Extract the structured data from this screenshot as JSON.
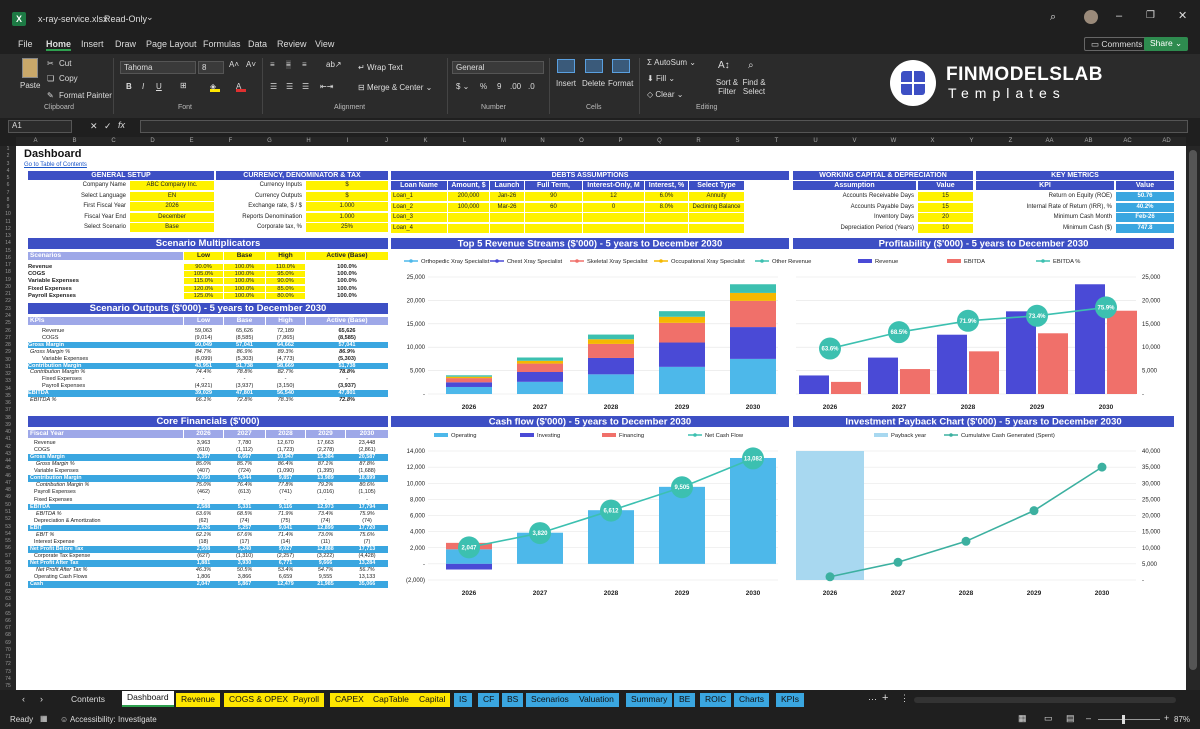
{
  "window": {
    "filename": "x-ray-service.xlsx",
    "mode": "Read-Only"
  },
  "menu": [
    "File",
    "Home",
    "Insert",
    "Draw",
    "Page Layout",
    "Formulas",
    "Data",
    "Review",
    "View"
  ],
  "menu_active": "Home",
  "topright": {
    "comments": "Comments",
    "share": "Share"
  },
  "ribbon": {
    "paste": "Paste",
    "cut": "Cut",
    "copy": "Copy",
    "format_painter": "Format Painter",
    "clipboard": "Clipboard",
    "font_name": "Tahoma",
    "font_size": "8",
    "font_label": "Font",
    "wrap": "Wrap Text",
    "merge": "Merge & Center",
    "alignment": "Alignment",
    "number_format": "General",
    "number": "Number",
    "insert": "Insert",
    "delete": "Delete",
    "format": "Format",
    "cells": "Cells",
    "autosum": "AutoSum",
    "fill": "Fill",
    "clear": "Clear",
    "sort": "Sort & Filter",
    "find": "Find & Select",
    "editing": "Editing",
    "logo_main": "FINMODELSLAB",
    "logo_sub": "Templates"
  },
  "formula": {
    "namebox": "A1",
    "fx": "fx"
  },
  "columns": [
    "A",
    "B",
    "C",
    "D",
    "E",
    "F",
    "G",
    "H",
    "I",
    "J",
    "K",
    "L",
    "M",
    "N",
    "O",
    "P",
    "Q",
    "R",
    "S",
    "T",
    "U",
    "V",
    "W",
    "X",
    "Y",
    "Z",
    "AA",
    "AB",
    "AC",
    "AD"
  ],
  "sheet": {
    "title": "Dashboard",
    "link": "Go to Table of Contents",
    "general_setup": {
      "header": "GENERAL SETUP",
      "rows": [
        [
          "Company Name",
          "ABC Company Inc."
        ],
        [
          "Select Language",
          "EN"
        ],
        [
          "First Fiscal Year",
          "2026"
        ],
        [
          "Fiscal Year End",
          "December"
        ],
        [
          "Select Scenario",
          "Base"
        ]
      ]
    },
    "currency": {
      "header": "CURRENCY, DENOMINATOR & TAX",
      "rows": [
        [
          "Currency Inputs",
          "$"
        ],
        [
          "Currency Outputs",
          "$"
        ],
        [
          "Exchange rate, $ / $",
          "1.000"
        ],
        [
          "Reports Denomination",
          "1.000"
        ],
        [
          "Corporate tax, %",
          "25%"
        ]
      ]
    },
    "debts": {
      "header": "DEBTS ASSUMPTIONS",
      "cols": [
        "Loan Name",
        "Amount, $",
        "Launch",
        "Full Term, Months",
        "Interest-Only, M",
        "Interest, %",
        "Select Type"
      ],
      "rows": [
        [
          "Loan_1",
          "200,000",
          "Jan-26",
          "90",
          "12",
          "6.0%",
          "Annuity"
        ],
        [
          "Loan_2",
          "100,000",
          "Mar-26",
          "60",
          "0",
          "8.0%",
          "Declining Balance"
        ],
        [
          "Loan_3",
          "",
          "",
          "",
          "",
          "",
          ""
        ],
        [
          "Loan_4",
          "",
          "",
          "",
          "",
          "",
          ""
        ]
      ]
    },
    "wc": {
      "header": "WORKING CAPITAL & DEPRECIATION",
      "cols": [
        "Assumption",
        "Value"
      ],
      "rows": [
        [
          "Accounts Receivable Days",
          "15"
        ],
        [
          "Accounts Payable Days",
          "15"
        ],
        [
          "Inventory Days",
          "20"
        ],
        [
          "Depreciation Period (Years)",
          "10"
        ]
      ]
    },
    "kpi": {
      "header": "KEY METRICS",
      "cols": [
        "KPI",
        "Value"
      ],
      "rows": [
        [
          "Return on Equity (ROE)",
          "50.76"
        ],
        [
          "Internal Rate of Return (IRR), %",
          "40.2%"
        ],
        [
          "Minimum Cash Month",
          "Feb-26"
        ],
        [
          "Minimum Cash ($)",
          "747.8"
        ]
      ]
    },
    "multipliers": {
      "header": "Scenario Multiplicators",
      "cols": [
        "Scenarios",
        "Low",
        "Base",
        "High",
        "Active (Base)"
      ],
      "rows": [
        [
          "Revenue",
          "90.0%",
          "100.0%",
          "110.0%",
          "100.0%"
        ],
        [
          "COGS",
          "105.0%",
          "100.0%",
          "95.0%",
          "100.0%"
        ],
        [
          "Variable Expenses",
          "115.0%",
          "100.0%",
          "90.0%",
          "100.0%"
        ],
        [
          "Fixed Expenses",
          "120.0%",
          "100.0%",
          "85.0%",
          "100.0%"
        ],
        [
          "Payroll Expenses",
          "125.0%",
          "100.0%",
          "80.0%",
          "100.0%"
        ]
      ]
    },
    "outputs": {
      "header": "Scenario Outputs ($'000) - 5 years to December 2030",
      "cols": [
        "KPIs",
        "Low",
        "Base",
        "High",
        "Active (Base)"
      ],
      "rows": [
        [
          "Revenue",
          "59,063",
          "65,626",
          "72,189",
          "65,626",
          ""
        ],
        [
          "COGS",
          "(9,014)",
          "(8,585)",
          "(7,865)",
          "(8,585)",
          ""
        ],
        [
          "Gross Margin",
          "50,049",
          "57,041",
          "64,662",
          "57,041",
          "h"
        ],
        [
          "Gross Margin %",
          "84.7%",
          "86.9%",
          "89.3%",
          "86.9%",
          "i"
        ],
        [
          "Variable Expenses",
          "(6,099)",
          "(5,303)",
          "(4,773)",
          "(5,303)",
          ""
        ],
        [
          "Contribution Margin",
          "43,951",
          "51,738",
          "58,669",
          "51,738",
          "h"
        ],
        [
          "Contribution Margin %",
          "74.4%",
          "78.8%",
          "82.7%",
          "78.8%",
          "i"
        ],
        [
          "Fixed Expenses",
          "-",
          "-",
          "-",
          "-",
          ""
        ],
        [
          "Payroll Expenses",
          "(4,921)",
          "(3,937)",
          "(3,150)",
          "(3,937)",
          ""
        ],
        [
          "EBITDA",
          "39,029",
          "47,801",
          "56,540",
          "47,801",
          "h"
        ],
        [
          "EBITDA %",
          "66.1%",
          "72.8%",
          "78.3%",
          "72.8%",
          "i"
        ]
      ]
    },
    "core": {
      "header": "Core Financials ($'000)",
      "cols": [
        "Fiscal Year",
        "2026",
        "2027",
        "2028",
        "2029",
        "2030"
      ],
      "rows": [
        [
          "Revenue",
          "3,963",
          "7,780",
          "12,670",
          "17,663",
          "23,448",
          ""
        ],
        [
          "COGS",
          "(610)",
          "(1,112)",
          "(1,723)",
          "(2,278)",
          "(2,861)",
          ""
        ],
        [
          "Gross Margin",
          "3,357",
          "6,667",
          "10,947",
          "15,384",
          "20,587",
          "h"
        ],
        [
          "Gross Margin %",
          "85.0%",
          "85.7%",
          "86.4%",
          "87.1%",
          "87.8%",
          "i"
        ],
        [
          "Variable Expenses",
          "(407)",
          "(724)",
          "(1,090)",
          "(1,395)",
          "(1,688)",
          ""
        ],
        [
          "Contribution Margin",
          "3,050",
          "5,944",
          "9,857",
          "13,989",
          "18,899",
          "h"
        ],
        [
          "Contribution Margin %",
          "75.0%",
          "76.4%",
          "77.8%",
          "79.2%",
          "80.6%",
          "i"
        ],
        [
          "Payroll Expenses",
          "(462)",
          "(613)",
          "(741)",
          "(1,016)",
          "(1,105)",
          ""
        ],
        [
          "Fixed Expenses",
          "-",
          "-",
          "-",
          "-",
          "-",
          ""
        ],
        [
          "EBITDA",
          "2,588",
          "5,331",
          "9,116",
          "12,973",
          "17,794",
          "h"
        ],
        [
          "EBITDA %",
          "63.6%",
          "68.5%",
          "71.9%",
          "73.4%",
          "75.9%",
          "i"
        ],
        [
          "Depreciation & Amortization",
          "(62)",
          "(74)",
          "(75)",
          "(74)",
          "(74)",
          ""
        ],
        [
          "EBIT",
          "2,526",
          "5,257",
          "9,041",
          "12,899",
          "17,720",
          "h"
        ],
        [
          "EBIT %",
          "62.1%",
          "67.6%",
          "71.4%",
          "73.0%",
          "75.6%",
          "i"
        ],
        [
          "Interest Expense",
          "(18)",
          "(17)",
          "(14)",
          "(11)",
          "(7)",
          ""
        ],
        [
          "Net Profit Before Tax",
          "2,508",
          "5,240",
          "9,027",
          "12,888",
          "17,713",
          "h"
        ],
        [
          "Corporate Tax Expense",
          "(627)",
          "(1,310)",
          "(2,257)",
          "(3,222)",
          "(4,428)",
          ""
        ],
        [
          "Net Profit After Tax",
          "1,881",
          "3,930",
          "6,771",
          "9,666",
          "13,284",
          "h"
        ],
        [
          "Net Profit After Tax %",
          "46.3%",
          "50.5%",
          "53.4%",
          "54.7%",
          "56.7%",
          "i"
        ],
        [
          "Operating Cash Flows",
          "1,806",
          "3,866",
          "6,659",
          "9,555",
          "13,133",
          ""
        ],
        [
          "Cash",
          "2,047",
          "5,867",
          "12,479",
          "21,985",
          "35,066",
          "h"
        ]
      ]
    }
  },
  "charts": {
    "revenue_streams": {
      "title": "Top 5 Revenue Streams ($'000) - 5 years to December 2030",
      "type": "bar",
      "legend": [
        "Orthopedic Xray Specialist",
        "Chest Xray Specialist",
        "Skeletal Xray Specialist",
        "Occupational Xray Specialist",
        "Other Revenue"
      ],
      "colors": [
        "#4db8ea",
        "#4a4ad6",
        "#f0706a",
        "#f5b800",
        "#3cc0b0"
      ],
      "categories": [
        "2026",
        "2027",
        "2028",
        "2029",
        "2030"
      ],
      "series": [
        [
          1500,
          2600,
          4200,
          5800,
          7500
        ],
        [
          1000,
          2100,
          3500,
          5200,
          6800
        ],
        [
          900,
          1800,
          3000,
          4200,
          5600
        ],
        [
          300,
          600,
          1000,
          1300,
          1700
        ],
        [
          300,
          700,
          1000,
          1200,
          1850
        ]
      ],
      "yticks": [
        "-",
        "5,000",
        "10,000",
        "15,000",
        "20,000",
        "25,000"
      ],
      "ymax": 25000
    },
    "profitability": {
      "title": "Profitability ($'000) - 5 years to December 2030",
      "type": "bar",
      "legend": [
        "Revenue",
        "EBITDA",
        "EBITDA %"
      ],
      "colors": [
        "#4a4ad6",
        "#f0706a",
        "#3cc0b0"
      ],
      "categories": [
        "2026",
        "2027",
        "2028",
        "2029",
        "2030"
      ],
      "revenue": [
        3963,
        7780,
        12670,
        17663,
        23448
      ],
      "ebitda": [
        2588,
        5331,
        9116,
        12973,
        17794
      ],
      "pct": [
        "63.6%",
        "68.5%",
        "71.9%",
        "73.4%",
        "75.9%"
      ],
      "pctv": [
        63.6,
        68.5,
        71.9,
        73.4,
        75.9
      ],
      "yticks": [
        "-",
        "5,000",
        "10,000",
        "15,000",
        "20,000",
        "25,000"
      ],
      "ymax": 25000
    },
    "cashflow": {
      "title": "Cash flow ($'000) - 5 years to December 2030",
      "type": "bar",
      "legend": [
        "Operating",
        "Investing",
        "Financing",
        "Net Cash Flow"
      ],
      "colors": [
        "#4db8ea",
        "#4a4ad6",
        "#f0706a",
        "#3cc0b0"
      ],
      "categories": [
        "2026",
        "2027",
        "2028",
        "2029",
        "2030"
      ],
      "operating": [
        1806,
        3866,
        6659,
        9555,
        13133
      ],
      "investing": [
        -700,
        0,
        0,
        0,
        0
      ],
      "financing": [
        800,
        0,
        0,
        0,
        0
      ],
      "net": [
        2047,
        3820,
        6612,
        9505,
        13082
      ],
      "labels": [
        "2,047",
        "3,820",
        "6,612",
        "9,505",
        "13,082"
      ],
      "yticks": [
        "(2,000)",
        "-",
        "2,000",
        "4,000",
        "6,000",
        "8,000",
        "10,000",
        "12,000",
        "14,000"
      ],
      "ymin": -2000,
      "ymax": 14000
    },
    "payback": {
      "title": "Investment Payback Chart ($'000) - 5 years to December 2030",
      "type": "line",
      "legend": [
        "Payback year",
        "Cumulative Cash Generated (Spent)"
      ],
      "colors": [
        "#a8d8f0",
        "#3cb0a0"
      ],
      "categories": [
        "2026",
        "2027",
        "2028",
        "2029",
        "2030"
      ],
      "values": [
        1000,
        5500,
        12000,
        21500,
        35000
      ],
      "yticks": [
        "-",
        "5,000",
        "10,000",
        "15,000",
        "20,000",
        "25,000",
        "30,000",
        "35,000",
        "40,000"
      ],
      "ymax": 40000
    }
  },
  "tabs": [
    {
      "name": "Contents",
      "color": "#1f1f1f",
      "text": "#ddd"
    },
    {
      "name": "Dashboard",
      "color": "#ffffff",
      "text": "#111"
    },
    {
      "name": "Revenue",
      "color": "#ffe600",
      "text": "#111"
    },
    {
      "name": "COGS & OPEX",
      "color": "#ffe600",
      "text": "#111"
    },
    {
      "name": "Payroll",
      "color": "#ffe600",
      "text": "#111"
    },
    {
      "name": "CAPEX",
      "color": "#ffe600",
      "text": "#111"
    },
    {
      "name": "CapTable",
      "color": "#ffe600",
      "text": "#111"
    },
    {
      "name": "Capital",
      "color": "#ffe600",
      "text": "#111"
    },
    {
      "name": "IS",
      "color": "#3aa6e0",
      "text": "#111"
    },
    {
      "name": "CF",
      "color": "#3aa6e0",
      "text": "#111"
    },
    {
      "name": "BS",
      "color": "#3aa6e0",
      "text": "#111"
    },
    {
      "name": "Scenarios",
      "color": "#3aa6e0",
      "text": "#111"
    },
    {
      "name": "Valuation",
      "color": "#3aa6e0",
      "text": "#111"
    },
    {
      "name": "Summary",
      "color": "#3aa6e0",
      "text": "#111"
    },
    {
      "name": "BE",
      "color": "#3aa6e0",
      "text": "#111"
    },
    {
      "name": "ROIC",
      "color": "#3aa6e0",
      "text": "#111"
    },
    {
      "name": "Charts",
      "color": "#3aa6e0",
      "text": "#111"
    },
    {
      "name": "KPIs",
      "color": "#3aa6e0",
      "text": "#111"
    }
  ],
  "status": {
    "ready": "Ready",
    "accessibility": "Accessibility: Investigate",
    "zoom": "87%"
  }
}
